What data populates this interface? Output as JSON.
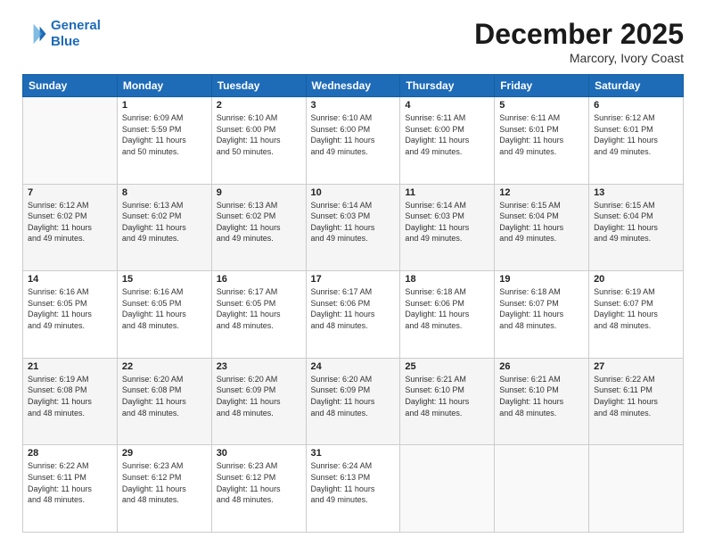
{
  "logo": {
    "line1": "General",
    "line2": "Blue"
  },
  "title": "December 2025",
  "subtitle": "Marcory, Ivory Coast",
  "header_days": [
    "Sunday",
    "Monday",
    "Tuesday",
    "Wednesday",
    "Thursday",
    "Friday",
    "Saturday"
  ],
  "weeks": [
    [
      {
        "day": "",
        "info": ""
      },
      {
        "day": "1",
        "info": "Sunrise: 6:09 AM\nSunset: 5:59 PM\nDaylight: 11 hours\nand 50 minutes."
      },
      {
        "day": "2",
        "info": "Sunrise: 6:10 AM\nSunset: 6:00 PM\nDaylight: 11 hours\nand 50 minutes."
      },
      {
        "day": "3",
        "info": "Sunrise: 6:10 AM\nSunset: 6:00 PM\nDaylight: 11 hours\nand 49 minutes."
      },
      {
        "day": "4",
        "info": "Sunrise: 6:11 AM\nSunset: 6:00 PM\nDaylight: 11 hours\nand 49 minutes."
      },
      {
        "day": "5",
        "info": "Sunrise: 6:11 AM\nSunset: 6:01 PM\nDaylight: 11 hours\nand 49 minutes."
      },
      {
        "day": "6",
        "info": "Sunrise: 6:12 AM\nSunset: 6:01 PM\nDaylight: 11 hours\nand 49 minutes."
      }
    ],
    [
      {
        "day": "7",
        "info": "Sunrise: 6:12 AM\nSunset: 6:02 PM\nDaylight: 11 hours\nand 49 minutes."
      },
      {
        "day": "8",
        "info": "Sunrise: 6:13 AM\nSunset: 6:02 PM\nDaylight: 11 hours\nand 49 minutes."
      },
      {
        "day": "9",
        "info": "Sunrise: 6:13 AM\nSunset: 6:02 PM\nDaylight: 11 hours\nand 49 minutes."
      },
      {
        "day": "10",
        "info": "Sunrise: 6:14 AM\nSunset: 6:03 PM\nDaylight: 11 hours\nand 49 minutes."
      },
      {
        "day": "11",
        "info": "Sunrise: 6:14 AM\nSunset: 6:03 PM\nDaylight: 11 hours\nand 49 minutes."
      },
      {
        "day": "12",
        "info": "Sunrise: 6:15 AM\nSunset: 6:04 PM\nDaylight: 11 hours\nand 49 minutes."
      },
      {
        "day": "13",
        "info": "Sunrise: 6:15 AM\nSunset: 6:04 PM\nDaylight: 11 hours\nand 49 minutes."
      }
    ],
    [
      {
        "day": "14",
        "info": "Sunrise: 6:16 AM\nSunset: 6:05 PM\nDaylight: 11 hours\nand 49 minutes."
      },
      {
        "day": "15",
        "info": "Sunrise: 6:16 AM\nSunset: 6:05 PM\nDaylight: 11 hours\nand 48 minutes."
      },
      {
        "day": "16",
        "info": "Sunrise: 6:17 AM\nSunset: 6:05 PM\nDaylight: 11 hours\nand 48 minutes."
      },
      {
        "day": "17",
        "info": "Sunrise: 6:17 AM\nSunset: 6:06 PM\nDaylight: 11 hours\nand 48 minutes."
      },
      {
        "day": "18",
        "info": "Sunrise: 6:18 AM\nSunset: 6:06 PM\nDaylight: 11 hours\nand 48 minutes."
      },
      {
        "day": "19",
        "info": "Sunrise: 6:18 AM\nSunset: 6:07 PM\nDaylight: 11 hours\nand 48 minutes."
      },
      {
        "day": "20",
        "info": "Sunrise: 6:19 AM\nSunset: 6:07 PM\nDaylight: 11 hours\nand 48 minutes."
      }
    ],
    [
      {
        "day": "21",
        "info": "Sunrise: 6:19 AM\nSunset: 6:08 PM\nDaylight: 11 hours\nand 48 minutes."
      },
      {
        "day": "22",
        "info": "Sunrise: 6:20 AM\nSunset: 6:08 PM\nDaylight: 11 hours\nand 48 minutes."
      },
      {
        "day": "23",
        "info": "Sunrise: 6:20 AM\nSunset: 6:09 PM\nDaylight: 11 hours\nand 48 minutes."
      },
      {
        "day": "24",
        "info": "Sunrise: 6:20 AM\nSunset: 6:09 PM\nDaylight: 11 hours\nand 48 minutes."
      },
      {
        "day": "25",
        "info": "Sunrise: 6:21 AM\nSunset: 6:10 PM\nDaylight: 11 hours\nand 48 minutes."
      },
      {
        "day": "26",
        "info": "Sunrise: 6:21 AM\nSunset: 6:10 PM\nDaylight: 11 hours\nand 48 minutes."
      },
      {
        "day": "27",
        "info": "Sunrise: 6:22 AM\nSunset: 6:11 PM\nDaylight: 11 hours\nand 48 minutes."
      }
    ],
    [
      {
        "day": "28",
        "info": "Sunrise: 6:22 AM\nSunset: 6:11 PM\nDaylight: 11 hours\nand 48 minutes."
      },
      {
        "day": "29",
        "info": "Sunrise: 6:23 AM\nSunset: 6:12 PM\nDaylight: 11 hours\nand 48 minutes."
      },
      {
        "day": "30",
        "info": "Sunrise: 6:23 AM\nSunset: 6:12 PM\nDaylight: 11 hours\nand 48 minutes."
      },
      {
        "day": "31",
        "info": "Sunrise: 6:24 AM\nSunset: 6:13 PM\nDaylight: 11 hours\nand 49 minutes."
      },
      {
        "day": "",
        "info": ""
      },
      {
        "day": "",
        "info": ""
      },
      {
        "day": "",
        "info": ""
      }
    ]
  ]
}
